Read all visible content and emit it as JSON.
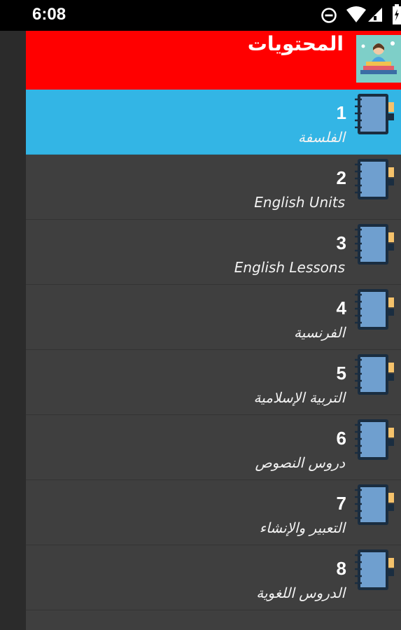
{
  "statusbar": {
    "time": "6:08",
    "icons": [
      "do-not-disturb-icon",
      "wifi-icon",
      "signal-icon",
      "battery-icon"
    ]
  },
  "drawer": {
    "title": "المحتويات",
    "avatar_icon": "student-reading-icon",
    "item_icon": "notebook-icon",
    "active_color": "#33b5e5",
    "header_color": "#ff0000",
    "items": [
      {
        "number": "1",
        "label": "الفلسفة"
      },
      {
        "number": "2",
        "label": "English Units"
      },
      {
        "number": "3",
        "label": "English Lessons"
      },
      {
        "number": "4",
        "label": "الفرنسية"
      },
      {
        "number": "5",
        "label": "التربية الإسلامية"
      },
      {
        "number": "6",
        "label": "دروس النصوص"
      },
      {
        "number": "7",
        "label": "التعبير والإنشاء"
      },
      {
        "number": "8",
        "label": "الدروس اللغوية"
      }
    ]
  }
}
